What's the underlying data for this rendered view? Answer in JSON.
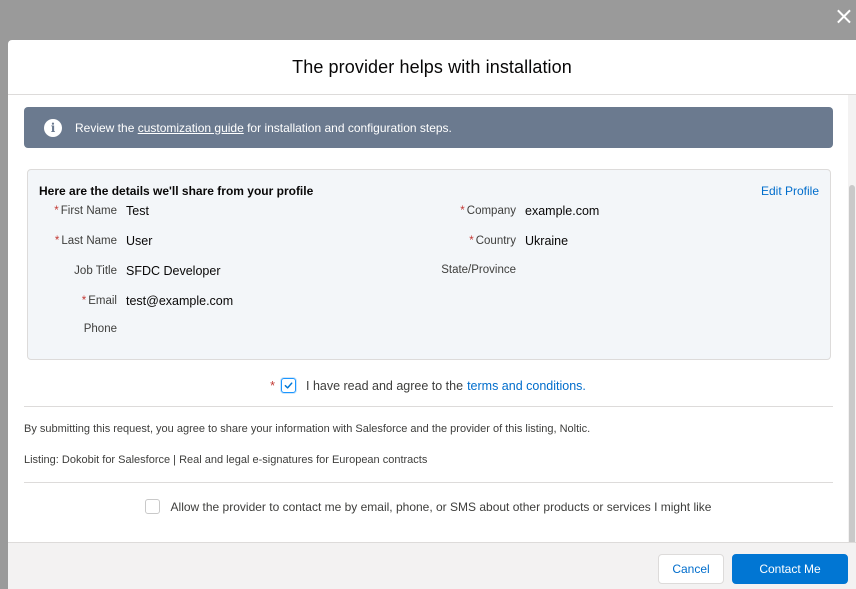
{
  "modal": {
    "close_glyph": "×",
    "title": "The provider helps with installation"
  },
  "banner": {
    "text_before": "Review the ",
    "link": "customization guide",
    "text_after": " for installation and configuration steps."
  },
  "profile": {
    "title": "Here are the details we'll share from your profile",
    "edit_label": "Edit Profile",
    "left_fields": [
      {
        "label": "First Name",
        "value": "Test",
        "required": true
      },
      {
        "label": "Last Name",
        "value": "User",
        "required": true
      },
      {
        "label": "Job Title",
        "value": "SFDC Developer",
        "required": false
      },
      {
        "label": "Email",
        "value": "test@example.com",
        "required": true
      },
      {
        "label": "Phone",
        "value": "",
        "required": false
      }
    ],
    "right_fields": [
      {
        "label": "Company",
        "value": "example.com",
        "required": true
      },
      {
        "label": "Country",
        "value": "Ukraine",
        "required": true
      },
      {
        "label": "State/Province",
        "value": "",
        "required": false
      }
    ]
  },
  "agree": {
    "required_mark": "*",
    "text": "I have read and agree to the",
    "link": "terms and conditions.",
    "checked": true
  },
  "disclaimer": "By submitting this request, you agree to share your information with Salesforce and the provider of this listing, Noltic.",
  "listing": "Listing: Dokobit for Salesforce | Real and legal e-signatures for European contracts",
  "optin": {
    "text": "Allow the provider to contact me by email, phone, or SMS about other products or services I might like",
    "checked": false
  },
  "footer": {
    "cancel_label": "Cancel",
    "contact_label": "Contact Me"
  },
  "colors": {
    "banner": "#6b7a8f",
    "brand": "#0176d3",
    "link": "#006dcc",
    "required": "#c23934"
  }
}
